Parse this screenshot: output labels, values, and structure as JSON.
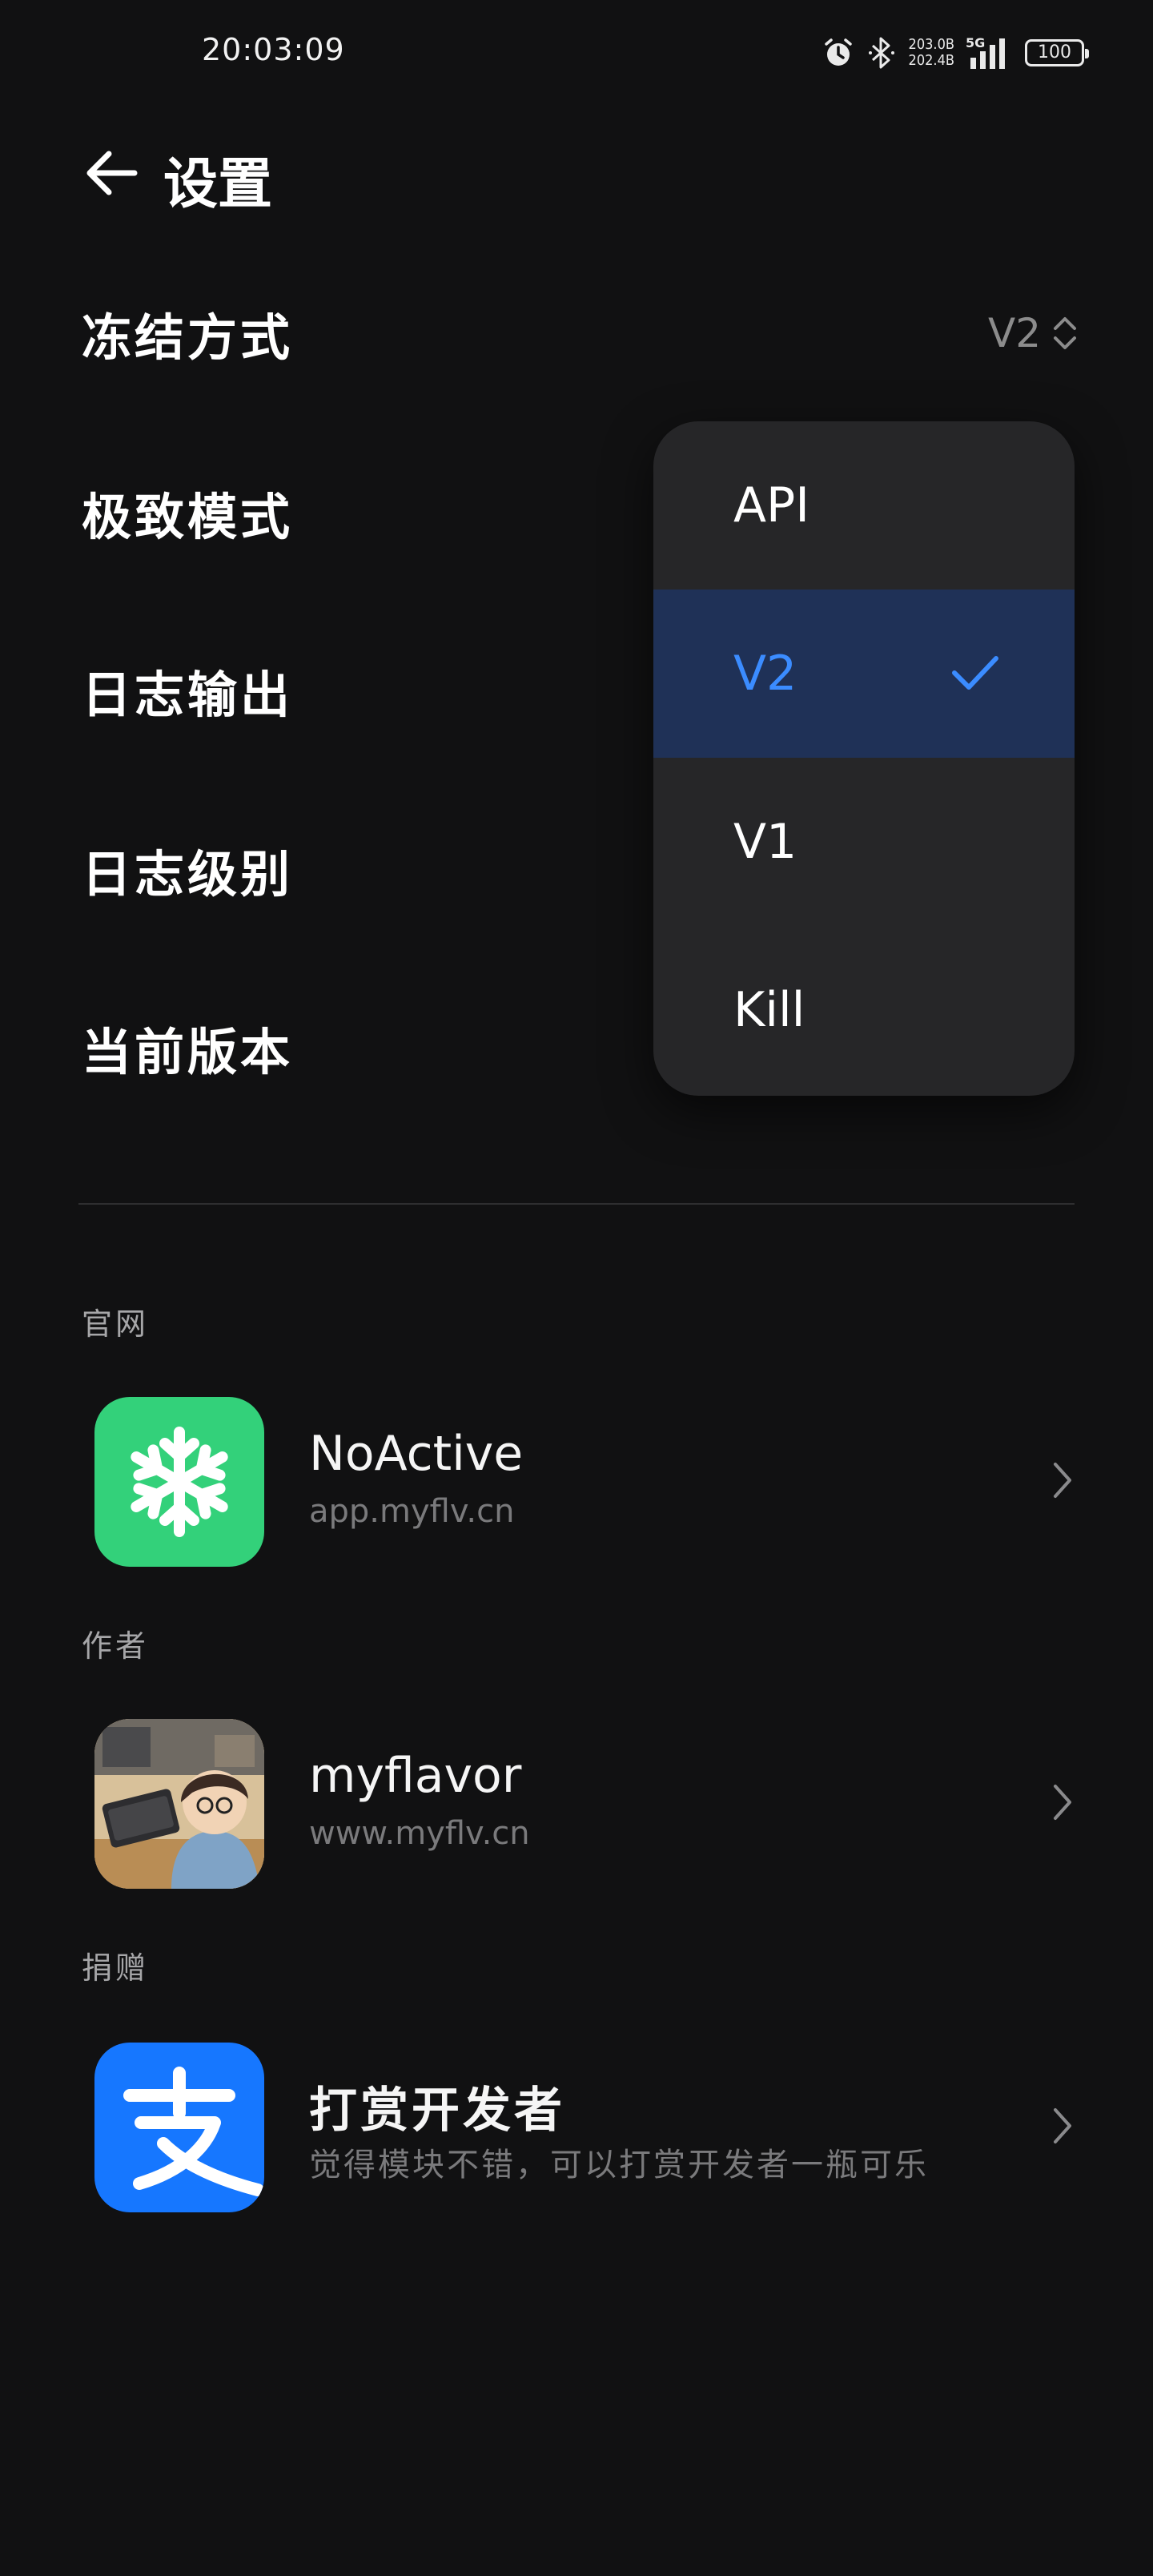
{
  "status_bar": {
    "time": "20:03:09",
    "net_up": "203.0B",
    "net_down": "202.4B",
    "network": "5G",
    "battery": "100",
    "icons": [
      "alarm-icon",
      "bluetooth-icon",
      "signal-icon",
      "battery-icon"
    ]
  },
  "header": {
    "title": "设置",
    "back_icon": "arrow-left-icon"
  },
  "settings": {
    "freeze_mode": {
      "label": "冻结方式",
      "value": "V2"
    },
    "extreme_mode": {
      "label": "极致模式"
    },
    "log_output": {
      "label": "日志输出"
    },
    "log_level": {
      "label": "日志级别"
    },
    "current_version": {
      "label": "当前版本"
    }
  },
  "dropdown": {
    "options": [
      "API",
      "V2",
      "V1",
      "Kill"
    ],
    "selected": "V2"
  },
  "sections": {
    "website": {
      "label": "官网",
      "title": "NoActive",
      "subtitle": "app.myflv.cn",
      "icon": "snowflake-icon",
      "icon_color": "#33d17a"
    },
    "author": {
      "label": "作者",
      "title": "myflavor",
      "subtitle": "www.myflv.cn",
      "icon": "avatar"
    },
    "donate": {
      "label": "捐赠",
      "title": "打赏开发者",
      "subtitle": "觉得模块不错，可以打赏开发者一瓶可乐",
      "icon": "alipay-icon",
      "icon_color": "#1677ff"
    }
  },
  "colors": {
    "background": "#111112",
    "accent": "#3b8cff",
    "dropdown_bg": "#262628",
    "selected_bg": "#1f3157"
  }
}
